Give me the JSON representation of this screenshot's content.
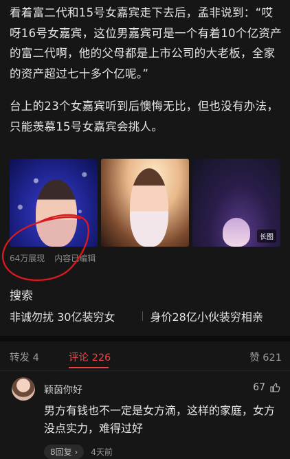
{
  "article": {
    "paragraphs": [
      "看着富二代和15号女嘉宾走下去后，孟非说到：“哎呀16号女嘉宾，这位男嘉宾可是一个有着10个亿资产的富二代啊，他的父母都是上市公司的大老板，全家的资产超过七十多个亿呢。”",
      "台上的23个女嘉宾听到后懊悔无比，但也没有办法，只能羡慕15号女嘉宾会挑人。"
    ],
    "images": [
      {
        "alt": "女嘉宾照片1",
        "icon": "photo-icon"
      },
      {
        "alt": "女嘉宾照片2",
        "icon": "photo-icon"
      },
      {
        "alt": "女嘉宾照片3",
        "icon": "photo-icon",
        "badge": "长图"
      }
    ],
    "views": "64万展现",
    "edited_note": "内容已编辑",
    "annotation_color": "#d8191f"
  },
  "search": {
    "title": "搜索",
    "suggestions": [
      "非诚勿扰 30亿装穷女",
      "身价28亿小伙装穷相亲"
    ]
  },
  "tabs": {
    "repost": "转发 4",
    "comments": "评论 226",
    "likes": "赞 621",
    "active_color": "#f04142"
  },
  "comments": [
    {
      "username": "颖茵你好",
      "likes": "67",
      "text": "男方有钱也不一定是女方滴，这样的家庭，女方没点实力，难得过好",
      "replies": "8回复",
      "time": "4天前"
    }
  ]
}
